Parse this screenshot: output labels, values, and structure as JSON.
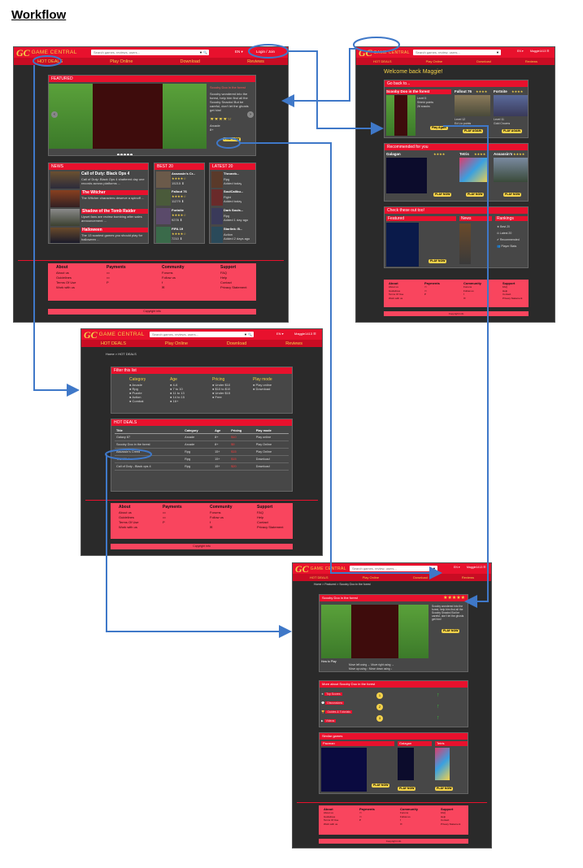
{
  "page_title": "Workflow",
  "brand": {
    "logo_mark": "GC",
    "logo_text": "GAME CENTRAL"
  },
  "search_placeholder": "Search games, reviews, users...",
  "search_placeholder_short": "Search games, review, users...",
  "lang": "EN ▾",
  "login": "Login / Join",
  "user_menu": "Maggie1413 ☰",
  "nav": [
    "HOT DEALS",
    "Play Online",
    "Download",
    "Reviews"
  ],
  "home": {
    "featured_title": "FEATURED",
    "featured_game": "Scooby Doo in the forest",
    "featured_desc": "Scooby wondered into the forest, help him find all the Scooby Snacks! But be careful, don't let the ghosts get him!",
    "stars": "★★★★☆",
    "meta": [
      "Arcade",
      "8+"
    ],
    "play_now": "PLAY NOW",
    "news": {
      "title": "NEWS",
      "items": [
        {
          "head": "Call of Duty: Black Ops 4",
          "body": "Call of Duty: Black Ops 4 shattered day one records across platforms ..."
        },
        {
          "head": "The Witcher",
          "body": "The Witcher characters deserve a spinoff ..."
        },
        {
          "head": "Shadow of the Tomb Raider",
          "body": "Upset fans are review bombing after sales announcement ..."
        },
        {
          "head": "Halloween",
          "body": "The 13 scariest games you should play for halloween ..."
        }
      ]
    },
    "best": {
      "title": "BEST 20",
      "items": [
        {
          "name": "Assassin's Cr...",
          "count": "15215 ⬇"
        },
        {
          "name": "Fallout 76",
          "count": "11279 ⬇"
        },
        {
          "name": "Fortnite",
          "count": "9278 ⬇"
        },
        {
          "name": "FIFA 19",
          "count": "7210 ⬇"
        }
      ]
    },
    "latest": {
      "title": "LATEST 20",
      "items": [
        {
          "name": "Throneb...",
          "genre": "Rpg",
          "when": "Added today"
        },
        {
          "name": "SoulCalibu...",
          "genre": "Fight",
          "when": "Added today"
        },
        {
          "name": "Dark Souls...",
          "genre": "Rpg",
          "when": "Added 1 day ago"
        },
        {
          "name": "Starlink: B...",
          "genre": "Action",
          "when": "Added 2 days ago"
        }
      ]
    }
  },
  "footer": {
    "cols": [
      {
        "title": "About",
        "items": [
          "About us",
          "Guidelines",
          "Terms Of Use",
          "Work with us"
        ]
      },
      {
        "title": "Payments",
        "items": [
          "▭",
          "▭",
          "P"
        ]
      },
      {
        "title": "Community",
        "items": [
          "Forums",
          "Follow us",
          "f",
          "✉"
        ]
      },
      {
        "title": "Support",
        "items": [
          "FAQ",
          "Help",
          "Contact",
          "Privacy Statement"
        ]
      }
    ],
    "copyright": "Copyright info"
  },
  "dashboard": {
    "welcome": "Welcome back Maggie!",
    "recent": {
      "title": "Go back to...",
      "games": [
        {
          "name": "Scooby Doo in the forest",
          "stars": "★★★★",
          "play": "Play Again"
        },
        {
          "name": "Fallout 76",
          "stars": "★★★★",
          "play": "PLAY AGAIN"
        },
        {
          "name": "Fortnite",
          "stars": "★★★★",
          "play": "PLAY AGAIN"
        }
      ]
    },
    "recommended": {
      "title": "Recommended for you",
      "games": [
        {
          "name": "Galagan",
          "stars": "★★★★",
          "play": "PLAY NOW"
        },
        {
          "name": "Tetris",
          "stars": "★★★★",
          "play": "PLAY NOW"
        },
        {
          "name": "Assassin's",
          "stars": "★★★★",
          "play": "PLAY NOW"
        }
      ]
    },
    "friends": {
      "title": "Check these out too!",
      "cols": [
        "Featured",
        "News",
        "Rankings"
      ],
      "play": "PLAY NOW"
    }
  },
  "hotdeals": {
    "breadcrumb": "Home > HOT DEALS",
    "filter": {
      "title": "Filter this list",
      "cols": [
        {
          "title": "Category",
          "items": [
            "Arcade",
            "Rpg",
            "Puzzle",
            "Action",
            "Combat"
          ]
        },
        {
          "title": "Age",
          "items": [
            "4-6",
            "7 to 10",
            "11 to 13",
            "14 to 15",
            "16+"
          ]
        },
        {
          "title": "Pricing",
          "items": [
            "Under $10",
            "$10 to $15",
            "Under $15",
            "Free"
          ]
        },
        {
          "title": "Play mode",
          "items": [
            "Play online",
            "Download"
          ]
        }
      ]
    },
    "table": {
      "title": "HOT DEALS",
      "headers": [
        "Title",
        "Category",
        "Age",
        "Pricing",
        "Play mode"
      ],
      "rows": [
        [
          "Galaxy 87",
          "Arcade",
          "8+",
          "$10",
          "Play online"
        ],
        [
          "Scooby Doo in the forest",
          "Arcade",
          "8+",
          "$9",
          "Play Online"
        ],
        [
          "Assassin's Creed",
          "Rpg",
          "15+",
          "$15",
          "Play Online"
        ],
        [
          "The Witcher",
          "Rpg",
          "15+",
          "$15",
          "Download"
        ],
        [
          "Call of Duty - Black ops 4",
          "Rpg",
          "15+",
          "$20",
          "Download"
        ]
      ]
    }
  },
  "gamepage": {
    "breadcrumb": "Home > Featured > Scooby Doo in the forest",
    "title": "Scooby Doo in the forest",
    "stars": "★★★★★",
    "desc": "Scooby wondered into the forest, help him find all the Scooby Snacks! But be careful, don't let the ghosts get him!",
    "play_now": "PLAY NOW",
    "how_to": "How to Play",
    "controls": [
      "Move left using ← Move right using →",
      "Move up using ↑ Move down using ↓"
    ],
    "more": {
      "title": "More about Scooby Doo in the forest",
      "rows": [
        "Top Scores",
        "Discussions",
        "Guides & Tutorials",
        "Videos"
      ]
    },
    "similar": {
      "title": "Similar games",
      "games": [
        {
          "name": "Pacman",
          "stars": "★★★★",
          "play": "PLAY NOW"
        },
        {
          "name": "Galagan",
          "stars": "★★★★",
          "play": "PLAY NOW"
        },
        {
          "name": "Tetris",
          "stars": "★★★★",
          "play": "PLAY NOW"
        }
      ]
    }
  }
}
